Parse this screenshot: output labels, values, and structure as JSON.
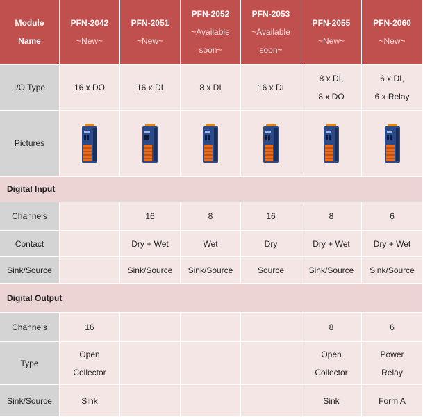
{
  "header": {
    "corner_line1": "Module",
    "corner_line2": "Name",
    "modules": [
      {
        "name": "PFN-2042",
        "status": [
          "~New~"
        ]
      },
      {
        "name": "PFN-2051",
        "status": [
          "~New~"
        ]
      },
      {
        "name": "PFN-2052",
        "status": [
          "~Available",
          "soon~"
        ]
      },
      {
        "name": "PFN-2053",
        "status": [
          "~Available",
          "soon~"
        ]
      },
      {
        "name": "PFN-2055",
        "status": [
          "~New~"
        ]
      },
      {
        "name": "PFN-2060",
        "status": [
          "~New~"
        ]
      }
    ]
  },
  "rows": {
    "io_type": {
      "label": "I/O Type",
      "values": [
        [
          "16 x DO"
        ],
        [
          "16 x DI"
        ],
        [
          "8 x DI"
        ],
        [
          "16 x DI"
        ],
        [
          "8 x DI,",
          "8 x DO"
        ],
        [
          "6 x DI,",
          "6 x Relay"
        ]
      ]
    },
    "pictures": {
      "label": "Pictures"
    }
  },
  "digital_input": {
    "title": "Digital Input",
    "channels": {
      "label": "Channels",
      "values": [
        "",
        "16",
        "8",
        "16",
        "8",
        "6"
      ]
    },
    "contact": {
      "label": "Contact",
      "values": [
        "",
        "Dry + Wet",
        "Wet",
        "Dry",
        "Dry + Wet",
        "Dry + Wet"
      ]
    },
    "sink_source": {
      "label": "Sink/Source",
      "values": [
        "",
        "Sink/Source",
        "Sink/Source",
        "Source",
        "Sink/Source",
        "Sink/Source"
      ]
    }
  },
  "digital_output": {
    "title": "Digital Output",
    "channels": {
      "label": "Channels",
      "values": [
        [
          "16"
        ],
        [
          ""
        ],
        [
          ""
        ],
        [
          ""
        ],
        [
          "8"
        ],
        [
          "6"
        ]
      ]
    },
    "type": {
      "label": "Type",
      "values": [
        [
          "Open",
          "Collector"
        ],
        [
          ""
        ],
        [
          ""
        ],
        [
          ""
        ],
        [
          "Open",
          "Collector"
        ],
        [
          "Power",
          "Relay"
        ]
      ]
    },
    "sink_source": {
      "label": "Sink/Source",
      "values": [
        [
          "Sink"
        ],
        [
          ""
        ],
        [
          ""
        ],
        [
          ""
        ],
        [
          "Sink"
        ],
        [
          "Form A"
        ]
      ]
    }
  },
  "colors": {
    "header_bg": "#c0504d",
    "label_bg": "#d4d4d4",
    "value_bg": "#f5e6e6",
    "section_bg": "#ecd4d4",
    "module_body": "#2b4a8a",
    "module_terminals": "#e86a1a",
    "module_top": "#d98a2a"
  }
}
